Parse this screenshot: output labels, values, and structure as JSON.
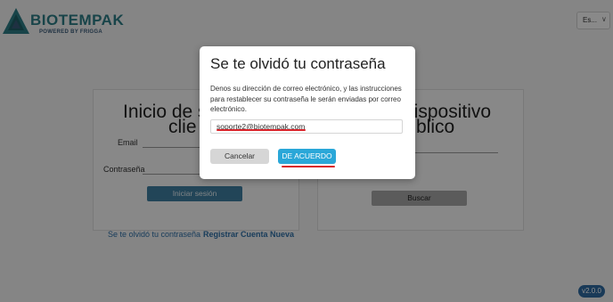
{
  "header": {
    "brand": "BIOTEMPAK",
    "tagline": "POWERED BY FRIGGA",
    "language": "Es..."
  },
  "login_card": {
    "title_line1": "Inicio de s",
    "title_line2": "clie",
    "email_label": "Email",
    "password_label": "Contraseña",
    "login_button": "Iniciar sesión"
  },
  "device_card": {
    "title_line1": "dispositivo",
    "title_line2": "blico",
    "search_button": "Buscar"
  },
  "links": {
    "forgot": "Se te olvidó tu contraseña",
    "register": "Registrar Cuenta Nueva"
  },
  "version": "v2.0.0",
  "modal": {
    "title": "Se te olvidó tu contraseña",
    "body": "Denos su dirección de correo electrónico, y las instrucciones para restablecer su contraseña le serán enviadas por correo electrónico.",
    "email_value": "soporte2@biotempak.com",
    "cancel_label": "Cancelar",
    "ok_label": "DE ACUERDO"
  },
  "colors": {
    "brand": "#2d7d86",
    "primary_button": "#2aa7d8",
    "annotation_red": "#d9232a",
    "overlay": "rgba(0,0,0,0.45)"
  },
  "icons": [
    "biotempak-logo-icon",
    "chevron-down-icon"
  ]
}
